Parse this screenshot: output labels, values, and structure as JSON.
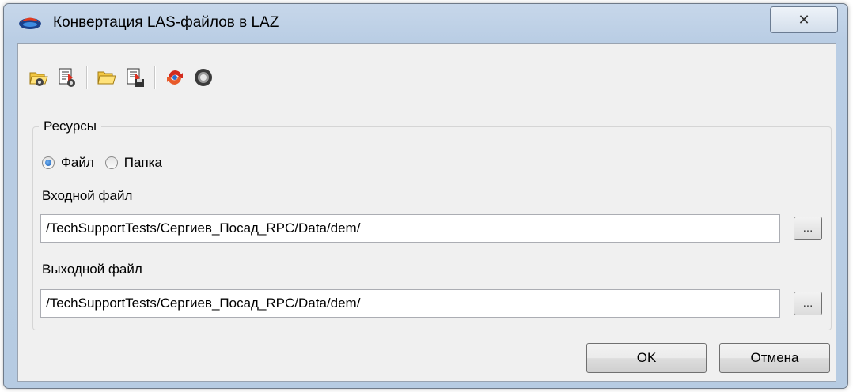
{
  "window": {
    "title": "Конвертация LAS-файлов в LAZ",
    "close_glyph": "✕"
  },
  "toolbar": {
    "buttons": [
      {
        "icon": "open-settings-icon"
      },
      {
        "icon": "save-settings-icon"
      },
      {
        "icon": "open-folder-icon"
      },
      {
        "icon": "save-file-icon"
      },
      {
        "icon": "refresh-icon"
      },
      {
        "icon": "run-icon"
      }
    ]
  },
  "resources": {
    "legend": "Ресурсы",
    "options": [
      {
        "label": "Файл",
        "checked": true
      },
      {
        "label": "Папка",
        "checked": false
      }
    ]
  },
  "input_file": {
    "label": "Входной файл",
    "value": "/TechSupportTests/Сергиев_Посад_RPC/Data/dem/",
    "browse_label": "..."
  },
  "output_file": {
    "label": "Выходной файл",
    "value": "/TechSupportTests/Сергиев_Посад_RPC/Data/dem/",
    "browse_label": "..."
  },
  "buttons": {
    "ok": "OK",
    "cancel": "Отмена"
  },
  "colors": {
    "titlebar": "#b9cde4",
    "client": "#f0f0f0",
    "accent": "#1b5fb8"
  }
}
